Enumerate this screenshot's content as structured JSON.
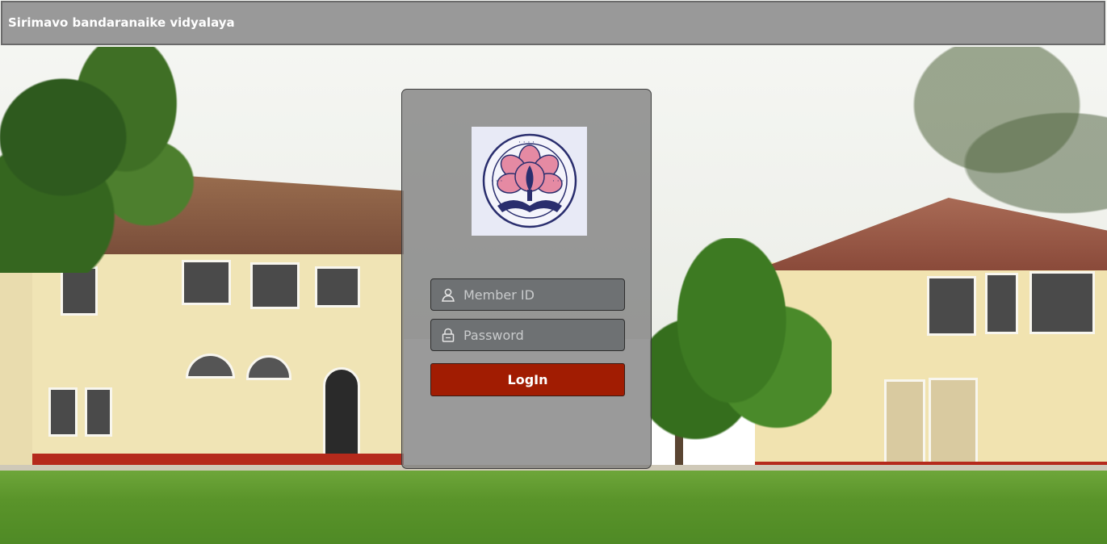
{
  "header": {
    "title": "Sirimavo bandaranaike vidyalaya"
  },
  "login": {
    "logo_icon": "school-crest-icon",
    "member_id": {
      "icon": "user-icon",
      "placeholder": "Member ID",
      "value": ""
    },
    "password": {
      "icon": "lock-icon",
      "placeholder": "Password",
      "value": ""
    },
    "submit_label": "LogIn"
  },
  "colors": {
    "header_bg": "#8c8c8c",
    "card_bg": "#7d7d7d",
    "field_bg": "#6e7173",
    "login_button": "#a11c02",
    "logo_bg": "#e8eaf6",
    "crest_pink": "#e58aa3",
    "crest_navy": "#2a2e6e"
  }
}
